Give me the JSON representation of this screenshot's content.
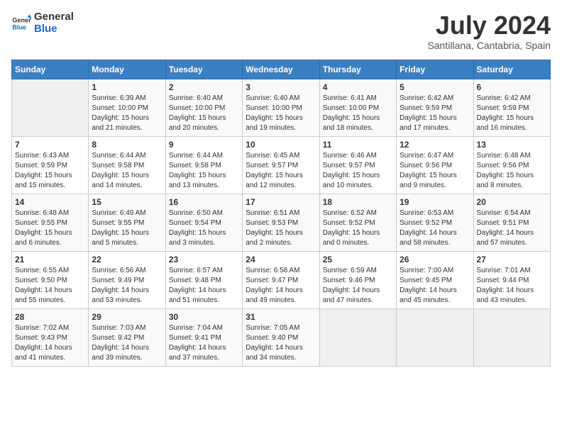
{
  "logo": {
    "line1": "General",
    "line2": "Blue"
  },
  "title": "July 2024",
  "subtitle": "Santillana, Cantabria, Spain",
  "days_header": [
    "Sunday",
    "Monday",
    "Tuesday",
    "Wednesday",
    "Thursday",
    "Friday",
    "Saturday"
  ],
  "weeks": [
    [
      {
        "num": "",
        "info": ""
      },
      {
        "num": "1",
        "info": "Sunrise: 6:39 AM\nSunset: 10:00 PM\nDaylight: 15 hours\nand 21 minutes."
      },
      {
        "num": "2",
        "info": "Sunrise: 6:40 AM\nSunset: 10:00 PM\nDaylight: 15 hours\nand 20 minutes."
      },
      {
        "num": "3",
        "info": "Sunrise: 6:40 AM\nSunset: 10:00 PM\nDaylight: 15 hours\nand 19 minutes."
      },
      {
        "num": "4",
        "info": "Sunrise: 6:41 AM\nSunset: 10:00 PM\nDaylight: 15 hours\nand 18 minutes."
      },
      {
        "num": "5",
        "info": "Sunrise: 6:42 AM\nSunset: 9:59 PM\nDaylight: 15 hours\nand 17 minutes."
      },
      {
        "num": "6",
        "info": "Sunrise: 6:42 AM\nSunset: 9:59 PM\nDaylight: 15 hours\nand 16 minutes."
      }
    ],
    [
      {
        "num": "7",
        "info": "Sunrise: 6:43 AM\nSunset: 9:59 PM\nDaylight: 15 hours\nand 15 minutes."
      },
      {
        "num": "8",
        "info": "Sunrise: 6:44 AM\nSunset: 9:58 PM\nDaylight: 15 hours\nand 14 minutes."
      },
      {
        "num": "9",
        "info": "Sunrise: 6:44 AM\nSunset: 9:58 PM\nDaylight: 15 hours\nand 13 minutes."
      },
      {
        "num": "10",
        "info": "Sunrise: 6:45 AM\nSunset: 9:57 PM\nDaylight: 15 hours\nand 12 minutes."
      },
      {
        "num": "11",
        "info": "Sunrise: 6:46 AM\nSunset: 9:57 PM\nDaylight: 15 hours\nand 10 minutes."
      },
      {
        "num": "12",
        "info": "Sunrise: 6:47 AM\nSunset: 9:56 PM\nDaylight: 15 hours\nand 9 minutes."
      },
      {
        "num": "13",
        "info": "Sunrise: 6:48 AM\nSunset: 9:56 PM\nDaylight: 15 hours\nand 8 minutes."
      }
    ],
    [
      {
        "num": "14",
        "info": "Sunrise: 6:48 AM\nSunset: 9:55 PM\nDaylight: 15 hours\nand 6 minutes."
      },
      {
        "num": "15",
        "info": "Sunrise: 6:49 AM\nSunset: 9:55 PM\nDaylight: 15 hours\nand 5 minutes."
      },
      {
        "num": "16",
        "info": "Sunrise: 6:50 AM\nSunset: 9:54 PM\nDaylight: 15 hours\nand 3 minutes."
      },
      {
        "num": "17",
        "info": "Sunrise: 6:51 AM\nSunset: 9:53 PM\nDaylight: 15 hours\nand 2 minutes."
      },
      {
        "num": "18",
        "info": "Sunrise: 6:52 AM\nSunset: 9:52 PM\nDaylight: 15 hours\nand 0 minutes."
      },
      {
        "num": "19",
        "info": "Sunrise: 6:53 AM\nSunset: 9:52 PM\nDaylight: 14 hours\nand 58 minutes."
      },
      {
        "num": "20",
        "info": "Sunrise: 6:54 AM\nSunset: 9:51 PM\nDaylight: 14 hours\nand 57 minutes."
      }
    ],
    [
      {
        "num": "21",
        "info": "Sunrise: 6:55 AM\nSunset: 9:50 PM\nDaylight: 14 hours\nand 55 minutes."
      },
      {
        "num": "22",
        "info": "Sunrise: 6:56 AM\nSunset: 9:49 PM\nDaylight: 14 hours\nand 53 minutes."
      },
      {
        "num": "23",
        "info": "Sunrise: 6:57 AM\nSunset: 9:48 PM\nDaylight: 14 hours\nand 51 minutes."
      },
      {
        "num": "24",
        "info": "Sunrise: 6:58 AM\nSunset: 9:47 PM\nDaylight: 14 hours\nand 49 minutes."
      },
      {
        "num": "25",
        "info": "Sunrise: 6:59 AM\nSunset: 9:46 PM\nDaylight: 14 hours\nand 47 minutes."
      },
      {
        "num": "26",
        "info": "Sunrise: 7:00 AM\nSunset: 9:45 PM\nDaylight: 14 hours\nand 45 minutes."
      },
      {
        "num": "27",
        "info": "Sunrise: 7:01 AM\nSunset: 9:44 PM\nDaylight: 14 hours\nand 43 minutes."
      }
    ],
    [
      {
        "num": "28",
        "info": "Sunrise: 7:02 AM\nSunset: 9:43 PM\nDaylight: 14 hours\nand 41 minutes."
      },
      {
        "num": "29",
        "info": "Sunrise: 7:03 AM\nSunset: 9:42 PM\nDaylight: 14 hours\nand 39 minutes."
      },
      {
        "num": "30",
        "info": "Sunrise: 7:04 AM\nSunset: 9:41 PM\nDaylight: 14 hours\nand 37 minutes."
      },
      {
        "num": "31",
        "info": "Sunrise: 7:05 AM\nSunset: 9:40 PM\nDaylight: 14 hours\nand 34 minutes."
      },
      {
        "num": "",
        "info": ""
      },
      {
        "num": "",
        "info": ""
      },
      {
        "num": "",
        "info": ""
      }
    ]
  ]
}
